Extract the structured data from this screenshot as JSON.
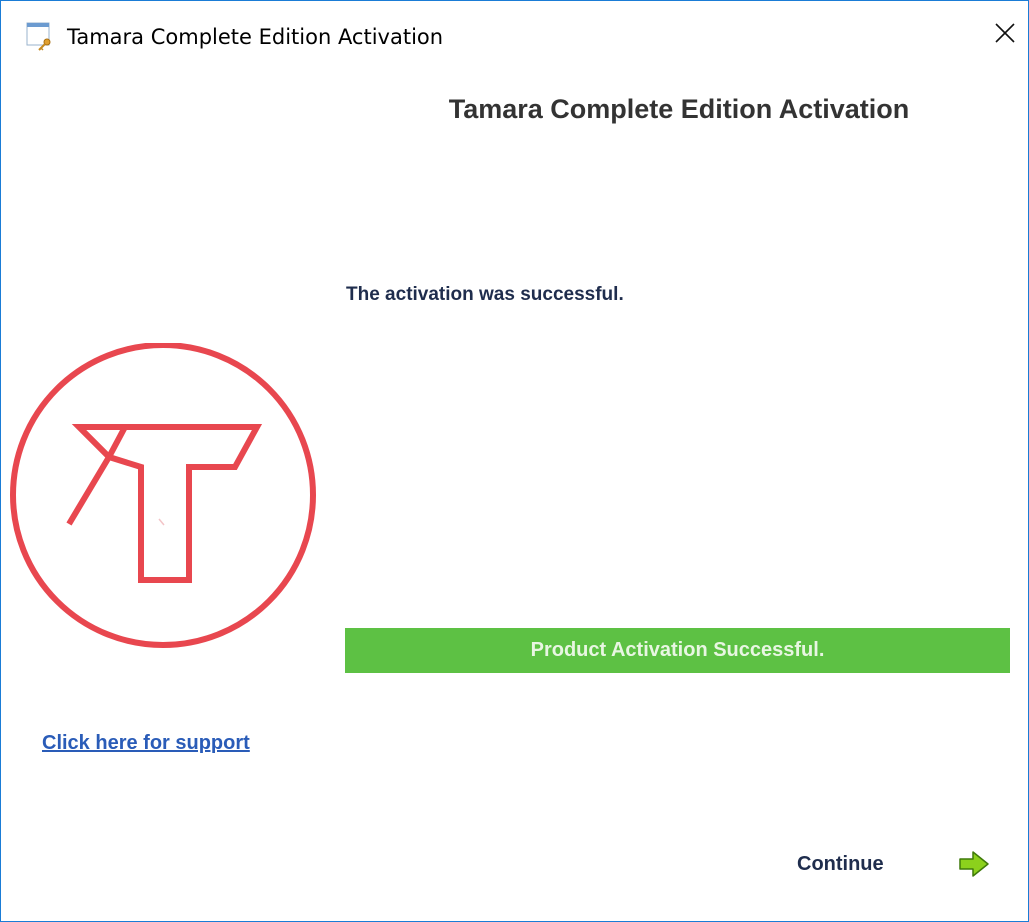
{
  "window": {
    "title": "Tamara Complete Edition Activation",
    "icon": "key-app-icon",
    "close_icon": "close-icon"
  },
  "main": {
    "heading": "Tamara Complete Edition Activation",
    "message": "The activation was successful.",
    "status_text": "Product Activation Successful.",
    "status_color": "#5dc144"
  },
  "logo": {
    "icon": "tamara-logo-icon",
    "color": "#e8474f"
  },
  "support": {
    "link_text": "Click here for support"
  },
  "footer": {
    "continue_label": "Continue",
    "continue_icon": "arrow-right-icon"
  }
}
